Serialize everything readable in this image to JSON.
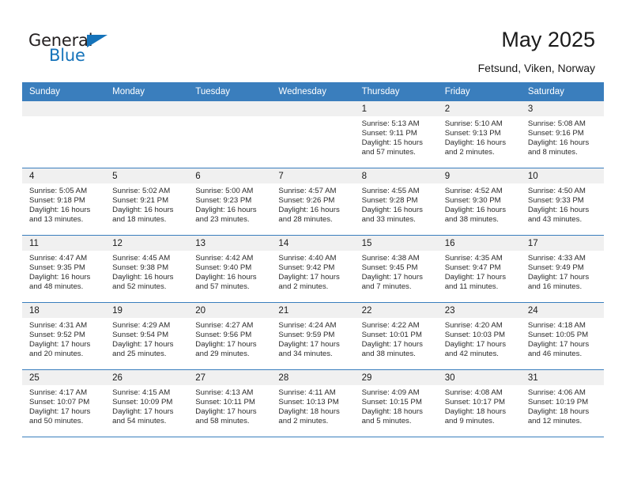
{
  "brand": {
    "name_part1": "General",
    "name_part2": "Blue",
    "accent_color": "#1573ba",
    "triangle_icon": "triangle-logo-icon"
  },
  "header": {
    "title": "May 2025",
    "subtitle": "Fetsund, Viken, Norway"
  },
  "calendar": {
    "header_bg": "#3a7ebd",
    "daynum_bg": "#f0f0f0",
    "weekdays": [
      "Sunday",
      "Monday",
      "Tuesday",
      "Wednesday",
      "Thursday",
      "Friday",
      "Saturday"
    ],
    "weeks": [
      [
        {
          "day": "",
          "blank": true
        },
        {
          "day": "",
          "blank": true
        },
        {
          "day": "",
          "blank": true
        },
        {
          "day": "",
          "blank": true
        },
        {
          "day": "1",
          "sunrise": "Sunrise: 5:13 AM",
          "sunset": "Sunset: 9:11 PM",
          "daylight": "Daylight: 15 hours and 57 minutes."
        },
        {
          "day": "2",
          "sunrise": "Sunrise: 5:10 AM",
          "sunset": "Sunset: 9:13 PM",
          "daylight": "Daylight: 16 hours and 2 minutes."
        },
        {
          "day": "3",
          "sunrise": "Sunrise: 5:08 AM",
          "sunset": "Sunset: 9:16 PM",
          "daylight": "Daylight: 16 hours and 8 minutes."
        }
      ],
      [
        {
          "day": "4",
          "sunrise": "Sunrise: 5:05 AM",
          "sunset": "Sunset: 9:18 PM",
          "daylight": "Daylight: 16 hours and 13 minutes."
        },
        {
          "day": "5",
          "sunrise": "Sunrise: 5:02 AM",
          "sunset": "Sunset: 9:21 PM",
          "daylight": "Daylight: 16 hours and 18 minutes."
        },
        {
          "day": "6",
          "sunrise": "Sunrise: 5:00 AM",
          "sunset": "Sunset: 9:23 PM",
          "daylight": "Daylight: 16 hours and 23 minutes."
        },
        {
          "day": "7",
          "sunrise": "Sunrise: 4:57 AM",
          "sunset": "Sunset: 9:26 PM",
          "daylight": "Daylight: 16 hours and 28 minutes."
        },
        {
          "day": "8",
          "sunrise": "Sunrise: 4:55 AM",
          "sunset": "Sunset: 9:28 PM",
          "daylight": "Daylight: 16 hours and 33 minutes."
        },
        {
          "day": "9",
          "sunrise": "Sunrise: 4:52 AM",
          "sunset": "Sunset: 9:30 PM",
          "daylight": "Daylight: 16 hours and 38 minutes."
        },
        {
          "day": "10",
          "sunrise": "Sunrise: 4:50 AM",
          "sunset": "Sunset: 9:33 PM",
          "daylight": "Daylight: 16 hours and 43 minutes."
        }
      ],
      [
        {
          "day": "11",
          "sunrise": "Sunrise: 4:47 AM",
          "sunset": "Sunset: 9:35 PM",
          "daylight": "Daylight: 16 hours and 48 minutes."
        },
        {
          "day": "12",
          "sunrise": "Sunrise: 4:45 AM",
          "sunset": "Sunset: 9:38 PM",
          "daylight": "Daylight: 16 hours and 52 minutes."
        },
        {
          "day": "13",
          "sunrise": "Sunrise: 4:42 AM",
          "sunset": "Sunset: 9:40 PM",
          "daylight": "Daylight: 16 hours and 57 minutes."
        },
        {
          "day": "14",
          "sunrise": "Sunrise: 4:40 AM",
          "sunset": "Sunset: 9:42 PM",
          "daylight": "Daylight: 17 hours and 2 minutes."
        },
        {
          "day": "15",
          "sunrise": "Sunrise: 4:38 AM",
          "sunset": "Sunset: 9:45 PM",
          "daylight": "Daylight: 17 hours and 7 minutes."
        },
        {
          "day": "16",
          "sunrise": "Sunrise: 4:35 AM",
          "sunset": "Sunset: 9:47 PM",
          "daylight": "Daylight: 17 hours and 11 minutes."
        },
        {
          "day": "17",
          "sunrise": "Sunrise: 4:33 AM",
          "sunset": "Sunset: 9:49 PM",
          "daylight": "Daylight: 17 hours and 16 minutes."
        }
      ],
      [
        {
          "day": "18",
          "sunrise": "Sunrise: 4:31 AM",
          "sunset": "Sunset: 9:52 PM",
          "daylight": "Daylight: 17 hours and 20 minutes."
        },
        {
          "day": "19",
          "sunrise": "Sunrise: 4:29 AM",
          "sunset": "Sunset: 9:54 PM",
          "daylight": "Daylight: 17 hours and 25 minutes."
        },
        {
          "day": "20",
          "sunrise": "Sunrise: 4:27 AM",
          "sunset": "Sunset: 9:56 PM",
          "daylight": "Daylight: 17 hours and 29 minutes."
        },
        {
          "day": "21",
          "sunrise": "Sunrise: 4:24 AM",
          "sunset": "Sunset: 9:59 PM",
          "daylight": "Daylight: 17 hours and 34 minutes."
        },
        {
          "day": "22",
          "sunrise": "Sunrise: 4:22 AM",
          "sunset": "Sunset: 10:01 PM",
          "daylight": "Daylight: 17 hours and 38 minutes."
        },
        {
          "day": "23",
          "sunrise": "Sunrise: 4:20 AM",
          "sunset": "Sunset: 10:03 PM",
          "daylight": "Daylight: 17 hours and 42 minutes."
        },
        {
          "day": "24",
          "sunrise": "Sunrise: 4:18 AM",
          "sunset": "Sunset: 10:05 PM",
          "daylight": "Daylight: 17 hours and 46 minutes."
        }
      ],
      [
        {
          "day": "25",
          "sunrise": "Sunrise: 4:17 AM",
          "sunset": "Sunset: 10:07 PM",
          "daylight": "Daylight: 17 hours and 50 minutes."
        },
        {
          "day": "26",
          "sunrise": "Sunrise: 4:15 AM",
          "sunset": "Sunset: 10:09 PM",
          "daylight": "Daylight: 17 hours and 54 minutes."
        },
        {
          "day": "27",
          "sunrise": "Sunrise: 4:13 AM",
          "sunset": "Sunset: 10:11 PM",
          "daylight": "Daylight: 17 hours and 58 minutes."
        },
        {
          "day": "28",
          "sunrise": "Sunrise: 4:11 AM",
          "sunset": "Sunset: 10:13 PM",
          "daylight": "Daylight: 18 hours and 2 minutes."
        },
        {
          "day": "29",
          "sunrise": "Sunrise: 4:09 AM",
          "sunset": "Sunset: 10:15 PM",
          "daylight": "Daylight: 18 hours and 5 minutes."
        },
        {
          "day": "30",
          "sunrise": "Sunrise: 4:08 AM",
          "sunset": "Sunset: 10:17 PM",
          "daylight": "Daylight: 18 hours and 9 minutes."
        },
        {
          "day": "31",
          "sunrise": "Sunrise: 4:06 AM",
          "sunset": "Sunset: 10:19 PM",
          "daylight": "Daylight: 18 hours and 12 minutes."
        }
      ]
    ]
  }
}
